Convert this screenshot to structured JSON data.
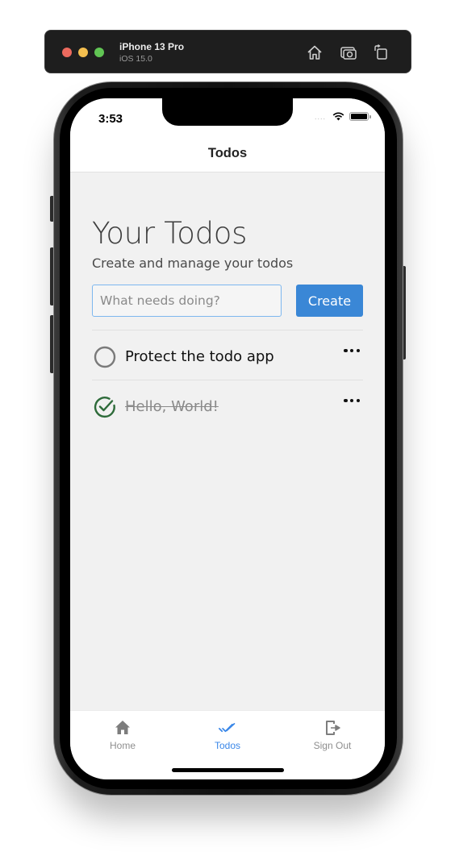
{
  "simulator": {
    "device_name": "iPhone 13 Pro",
    "os_version": "iOS 15.0",
    "toolbar_icons": [
      "home-icon",
      "screenshot-icon",
      "rotate-icon"
    ]
  },
  "status_bar": {
    "time": "3:53",
    "signal": "....",
    "battery_level": 1.0
  },
  "nav": {
    "title": "Todos"
  },
  "page": {
    "title": "Your Todos",
    "subtitle": "Create and manage your todos",
    "input": {
      "value": "",
      "placeholder": "What needs doing?"
    },
    "create_label": "Create"
  },
  "todos": [
    {
      "text": "Protect the todo app",
      "completed": false,
      "icon": "circle-unchecked-icon",
      "menu_icon": "more-horizontal-icon"
    },
    {
      "text": "Hello, World!",
      "completed": true,
      "icon": "circle-check-icon",
      "menu_icon": "more-horizontal-icon"
    }
  ],
  "colors": {
    "accent": "#3a87d6",
    "tab_active": "#3a87e8",
    "completed_check": "#2e6b3a",
    "unchecked_circle": "#7a7a7a"
  },
  "tabs": [
    {
      "label": "Home",
      "icon": "home-icon",
      "active": false
    },
    {
      "label": "Todos",
      "icon": "double-check-icon",
      "active": true
    },
    {
      "label": "Sign Out",
      "icon": "sign-out-icon",
      "active": false
    }
  ]
}
